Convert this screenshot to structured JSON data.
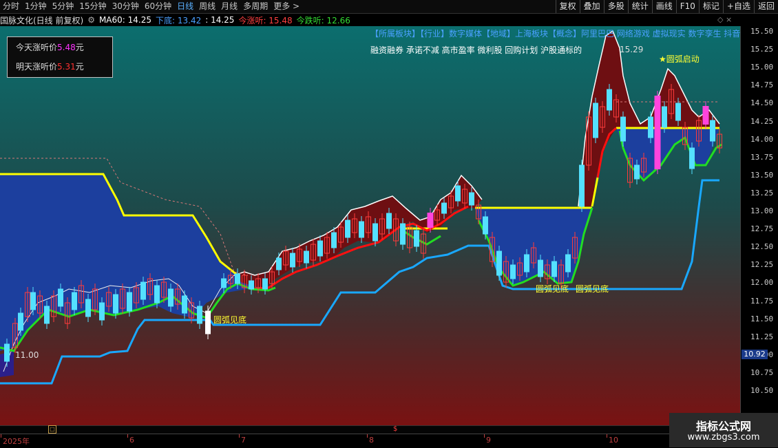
{
  "toolbar": {
    "periods": [
      "分时",
      "1分钟",
      "5分钟",
      "15分钟",
      "30分钟",
      "60分钟",
      "日线",
      "周线",
      "月线",
      "多周期",
      "更多 >"
    ],
    "active_index": 6,
    "right": [
      "复权",
      "叠加",
      "多股",
      "统计",
      "画线",
      "F10",
      "标记",
      "+自选",
      "返回"
    ]
  },
  "info": {
    "title": "国脉文化(日线 前复权)",
    "ma": "MA60: 14.25",
    "bottom_label": "下底: 13.42",
    "bottom_val": ": 14.25",
    "up_label": "今涨听: 15.48",
    "down_label": "今跌听: 12.66",
    "diamond": "◇ ×"
  },
  "legend": {
    "today_label": "今天涨听价",
    "today_val": "5.48",
    "today_unit": "元",
    "tomorrow_label": "明天涨听价",
    "tomorrow_val": "5.31",
    "tomorrow_unit": "元"
  },
  "concept": {
    "line1": "【所属板块】【行业】数字媒体【地域】上海板块【概念】阿里巴巴 网络游戏 虚拟现实 数字孪生 抖音",
    "line2": "融资融券 承诺不减 高市盈率 微利股 回购计划 沪股通标的"
  },
  "annotations": {
    "low_price": "11.00",
    "high_price": "15.29",
    "start": "★圆弧启动",
    "bottom1": "圆弧见底",
    "bottom2": "圆弧见底",
    "bottom3": "圆弧见底"
  },
  "yaxis": {
    "labels": [
      "15.50",
      "15.25",
      "15.00",
      "14.75",
      "14.50",
      "14.25",
      "14.00",
      "13.75",
      "13.50",
      "13.25",
      "13.00",
      "12.75",
      "12.50",
      "12.25",
      "12.00",
      "11.75",
      "11.50",
      "11.25",
      "11.00",
      "10.75",
      "10.50"
    ],
    "current": "10.92"
  },
  "xaxis": {
    "labels": [
      "2025年",
      "6",
      "7",
      "8",
      "9",
      "10"
    ]
  },
  "watermark": {
    "line1": "指标公式网",
    "line2": "www.zbgs3.com"
  },
  "colors": {
    "blue_area": "#1c3f9e",
    "red_area": "#6e0f12",
    "yellow": "#ffff00",
    "green": "#22dd22",
    "red_line": "#ff1010",
    "cyan_line": "#19a8ff",
    "up_candle": "#ff3b3b",
    "down_candle": "#54e0ff"
  }
}
